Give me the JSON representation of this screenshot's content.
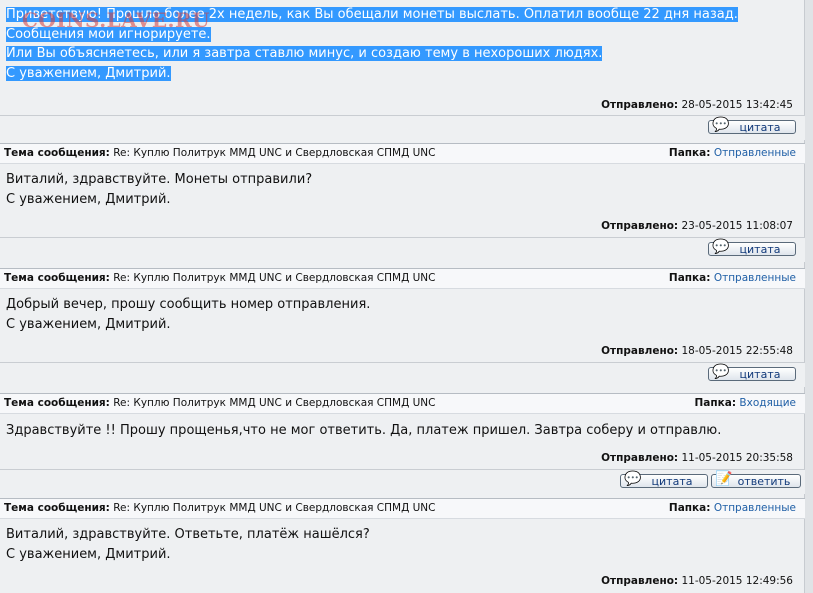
{
  "watermark": "COINS.LAVE.RU",
  "labels": {
    "subject": "Тема сообщения:",
    "folder": "Папка:",
    "sent": "Отправлено:",
    "quote": "цитата",
    "reply": "ответить"
  },
  "first_message": {
    "lines": [
      "Приветствую! Прошло более 2х недель, как Вы обещали монеты выслать. Оплатил вообще 22 дня назад.",
      "Сообщения мои игнорируете.",
      "Или Вы объясняетесь, или я завтра ставлю минус, и создаю тему в нехороших людях.",
      "С уважением, Дмитрий."
    ],
    "sent": "28-05-2015 13:42:45"
  },
  "messages": [
    {
      "subject": "Re: Куплю Политрук ММД UNC и Свердловская СПМД UNC",
      "folder": "Отправленные",
      "lines": [
        "Виталий, здравствуйте. Монеты отправили?",
        "С уважением, Дмитрий."
      ],
      "sent": "23-05-2015 11:08:07"
    },
    {
      "subject": "Re: Куплю Политрук ММД UNC и Свердловская СПМД UNC",
      "folder": "Отправленные",
      "lines": [
        "Добрый вечер, прошу сообщить номер отправления.",
        "С уважением, Дмитрий."
      ],
      "sent": "18-05-2015 22:55:48"
    },
    {
      "subject": "Re: Куплю Политрук ММД UNC и Свердловская СПМД UNC",
      "folder": "Входящие",
      "lines": [
        "Здравствуйте !! Прошу прощенья,что не мог ответить. Да, платеж пришел. Завтра соберу и отправлю."
      ],
      "sent": "11-05-2015 20:35:58"
    },
    {
      "subject": "Re: Куплю Политрук ММД UNC и Свердловская СПМД UNC",
      "folder": "Отправленные",
      "lines": [
        "Виталий, здравствуйте. Ответьте, платёж нашёлся?",
        "С уважением, Дмитрий."
      ],
      "sent": "11-05-2015 12:49:56"
    }
  ]
}
